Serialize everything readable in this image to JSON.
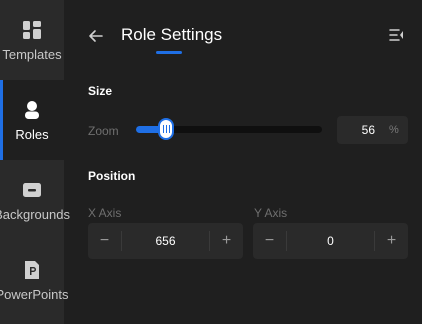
{
  "sidebar": {
    "items": [
      {
        "label": "Templates",
        "icon": "templates-icon"
      },
      {
        "label": "Roles",
        "icon": "roles-icon"
      },
      {
        "label": "Backgrounds",
        "icon": "backgrounds-icon"
      },
      {
        "label": "PowerPoints",
        "icon": "powerpoints-icon"
      }
    ],
    "active": "Roles"
  },
  "header": {
    "title": "Role Settings"
  },
  "size": {
    "section_label": "Size",
    "zoom_label": "Zoom",
    "zoom_value": "56",
    "zoom_unit": "%",
    "zoom_percent": 0.16
  },
  "position": {
    "section_label": "Position",
    "x_label": "X Axis",
    "x_value": "656",
    "y_label": "Y Axis",
    "y_value": "0",
    "minus_symbol": "−",
    "plus_symbol": "+"
  },
  "colors": {
    "accent": "#1f6fe5",
    "background": "#1f1f1f",
    "sidebar": "#2a2a2a"
  }
}
